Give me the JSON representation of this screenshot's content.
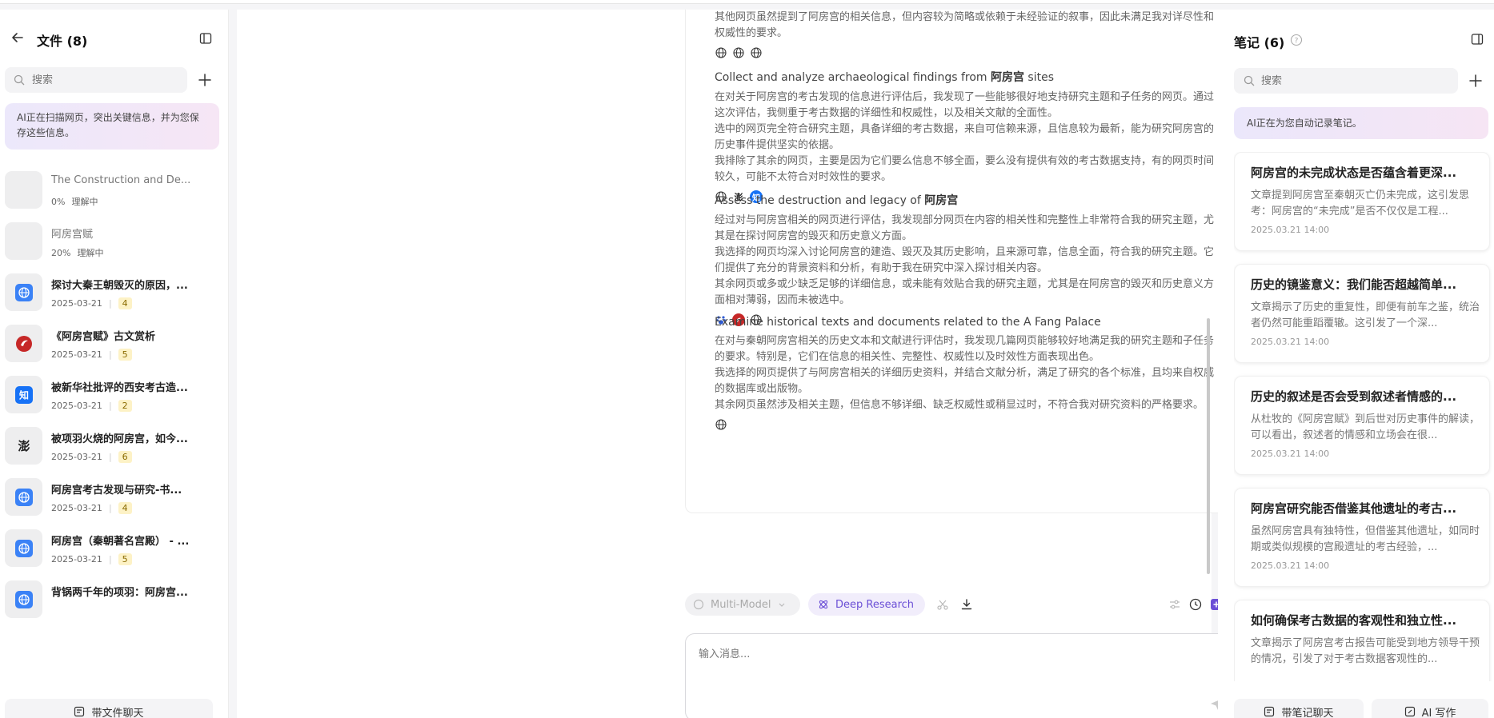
{
  "left": {
    "title": "文件 (8)",
    "search_placeholder": "搜索",
    "banner": "AI正在扫描网页，突出关键信息，并为您保存这些信息。",
    "bottom_button": "带文件聊天",
    "files": [
      {
        "name": "The Construction and De...",
        "date": "0%",
        "status": "理解中",
        "icon": "blank",
        "dim": true
      },
      {
        "name": "阿房宫赋",
        "date": "20%",
        "status": "理解中",
        "icon": "blank",
        "dim": true
      },
      {
        "name": "探讨大秦王朝毁灭的原因，...",
        "date": "2025-03-21",
        "count": "4",
        "icon": "globe-icon"
      },
      {
        "name": "《阿房宫赋》古文赏析",
        "date": "2025-03-21",
        "count": "5",
        "icon": "red-logo-icon"
      },
      {
        "name": "被新华社批评的西安考古造...",
        "date": "2025-03-21",
        "count": "2",
        "icon": "zhihu-icon"
      },
      {
        "name": "被项羽火烧的阿房宫，如今...",
        "date": "2025-03-21",
        "count": "6",
        "icon": "ink-logo-icon"
      },
      {
        "name": "阿房宫考古发现与研究-书...",
        "date": "2025-03-21",
        "count": "4",
        "icon": "globe-icon"
      },
      {
        "name": "阿房宫（秦朝著名宫殿） - ...",
        "date": "2025-03-21",
        "count": "5",
        "icon": "globe-icon"
      },
      {
        "name": "背锅两千年的项羽：阿房宫...",
        "date": "",
        "count": "",
        "icon": "globe-icon"
      }
    ]
  },
  "main": {
    "intro": "其他网页虽然提到了阿房宫的相关信息，但内容较为简略或依赖于未经验证的叙事，因此未满足我对详尽性和权威性的要求。",
    "sections": [
      {
        "title_prefix": "Collect and analyze archaeological findings from ",
        "title_bold": "阿房宫",
        "title_suffix": " sites",
        "paras": [
          "在对关于阿房宫的考古发现的信息进行评估后，我发现了一些能够很好地支持研究主题和子任务的网页。通过这次评估，我侧重于考古数据的详细性和权威性，以及相关文献的全面性。",
          "选中的网页完全符合研究主题，具备详细的考古数据，来自可信赖来源，且信息较为最新，能为研究阿房宫的历史事件提供坚实的依据。",
          "我排除了其余的网页，主要是因为它们要么信息不够全面，要么没有提供有效的考古数据支持，有的网页时间较久，可能不太符合对时效性的要求。"
        ],
        "sources": [
          "globe",
          "ink",
          "zhihu"
        ]
      },
      {
        "title_prefix": "Assess the destruction and legacy of ",
        "title_bold": "阿房宫",
        "title_suffix": "",
        "paras": [
          "经过对与阿房宫相关的网页进行评估，我发现部分网页在内容的相关性和完整性上非常符合我的研究主题，尤其是在探讨阿房宫的毁灭和历史意义方面。",
          "我选择的网页均深入讨论阿房宫的建造、毁灭及其历史影响，且来源可靠，信息全面，符合我的研究主题。它们提供了充分的背景资料和分析，有助于我在研究中深入探讨相关内容。",
          "其余网页或多或少缺乏足够的详细信息，或未能有效贴合我的研究主题，尤其是在阿房宫的毁灭和历史意义方面相对薄弱，因而未被选中。"
        ],
        "sources": [
          "baidu",
          "red",
          "globe"
        ]
      },
      {
        "title_prefix": "Examine historical texts and documents related to the A Fang Palace",
        "title_bold": "",
        "title_suffix": "",
        "paras": [
          "在对与秦朝阿房宫相关的历史文本和文献进行评估时，我发现几篇网页能够较好地满足我的研究主题和子任务的要求。特别是，它们在信息的相关性、完整性、权威性以及时效性方面表现出色。",
          "我选择的网页提供了与阿房宫相关的详细历史资料，并结合文献分析，满足了研究的各个标准，且均来自权威的数据库或出版物。",
          "其余网页虽然涉及相关主题，但信息不够详细、缺乏权威性或稍显过时，不符合我对研究资料的严格要求。"
        ],
        "sources": [
          "globe"
        ]
      }
    ]
  },
  "composer": {
    "model_label": "Multi-Model",
    "deep_research_label": "Deep Research",
    "placeholder": "输入消息..."
  },
  "right": {
    "title": "笔记 (6)",
    "search_placeholder": "搜索",
    "banner": "AI正在为您自动记录笔记。",
    "notes": [
      {
        "title": "阿房宫的未完成状态是否蕴含着更深...",
        "body": "文章提到阿房宫至秦朝灭亡仍未完成，这引发思考：阿房宫的“未完成”是否不仅仅是工程...",
        "date": "2025.03.21 14:00"
      },
      {
        "title": "历史的镜鉴意义：我们能否超越简单...",
        "body": "文章揭示了历史的重复性，即便有前车之鉴，统治者仍然可能重蹈覆辙。这引发了一个深...",
        "date": "2025.03.21 14:00"
      },
      {
        "title": "历史的叙述是否会受到叙述者情感的...",
        "body": "从杜牧的《阿房宫赋》到后世对历史事件的解读，可以看出，叙述者的情感和立场会在很...",
        "date": "2025.03.21 14:00"
      },
      {
        "title": "阿房宫研究能否借鉴其他遗址的考古...",
        "body": "虽然阿房宫具有独特性，但借鉴其他遗址，如同时期或类似规模的宫殿遗址的考古经验，...",
        "date": "2025.03.21 14:00"
      },
      {
        "title": "如何确保考古数据的客观性和独立性...",
        "body": "文章揭示了阿房宫考古报告可能受到地方领导干预的情况，引发了对于考古数据客观性的...",
        "date": ""
      }
    ],
    "chat_button": "带笔记聊天",
    "write_button": "AI 写作"
  },
  "colors": {
    "accent": "#6b4fd6",
    "badge_bg": "#fdf2c6",
    "globe": "#3b82f6",
    "red": "#c62828",
    "zhihu": "#1772f6"
  }
}
